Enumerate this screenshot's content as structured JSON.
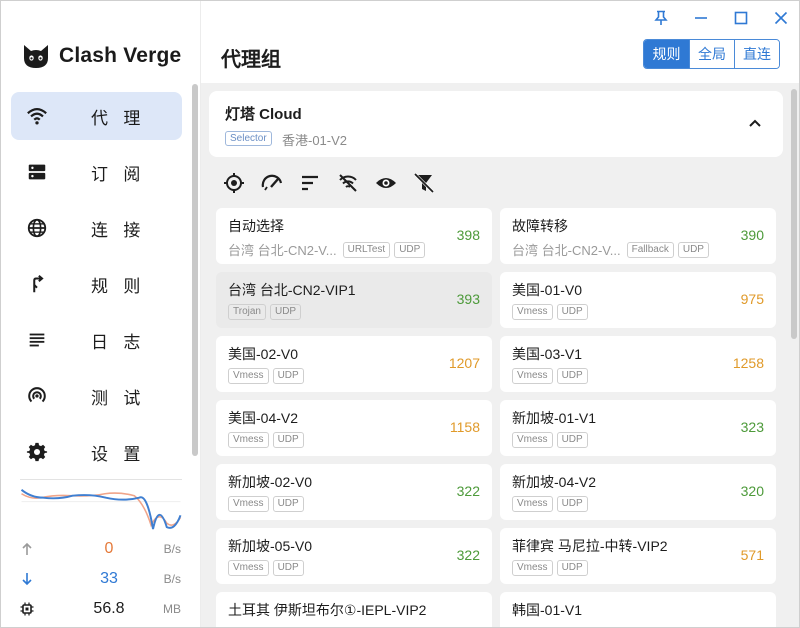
{
  "app": {
    "name": "Clash Verge"
  },
  "sidebar": {
    "items": [
      {
        "label": "代 理",
        "icon": "wifi-icon",
        "active": true
      },
      {
        "label": "订 阅",
        "icon": "server-icon",
        "active": false
      },
      {
        "label": "连 接",
        "icon": "globe-icon",
        "active": false
      },
      {
        "label": "规 则",
        "icon": "fork-arrow-icon",
        "active": false
      },
      {
        "label": "日 志",
        "icon": "log-lines-icon",
        "active": false
      },
      {
        "label": "测 试",
        "icon": "radar-icon",
        "active": false
      },
      {
        "label": "设 置",
        "icon": "gear-icon",
        "active": false
      }
    ],
    "traffic": {
      "upload": {
        "value": "0",
        "unit": "B/s",
        "color": "#e57a3a"
      },
      "download": {
        "value": "33",
        "unit": "B/s",
        "color": "#2f79d4"
      },
      "memory": {
        "value": "56.8",
        "unit": "MB"
      }
    }
  },
  "header": {
    "title": "代理组",
    "modes": [
      {
        "label": "规则",
        "active": true
      },
      {
        "label": "全局",
        "active": false
      },
      {
        "label": "直连",
        "active": false
      }
    ],
    "window_controls": [
      "pin-icon",
      "minimize-icon",
      "maximize-icon",
      "close-icon"
    ]
  },
  "group": {
    "name": "灯塔 Cloud",
    "type": "Selector",
    "now": "香港-01-V2"
  },
  "toolbar": [
    "locate-icon",
    "speed-test-icon",
    "sort-icon",
    "filter-off-icon",
    "eye-icon",
    "filter-clear-icon"
  ],
  "proxies": [
    {
      "name": "自动选择",
      "loc": "台湾 台北-CN2-V...",
      "tags": [
        "URLTest",
        "UDP"
      ],
      "delay": "398",
      "level": "green"
    },
    {
      "name": "故障转移",
      "loc": "台湾 台北-CN2-V...",
      "tags": [
        "Fallback",
        "UDP"
      ],
      "delay": "390",
      "level": "green"
    },
    {
      "name": "台湾 台北-CN2-VIP1",
      "loc": "",
      "tags": [
        "Trojan",
        "UDP"
      ],
      "delay": "393",
      "level": "green",
      "selected": true
    },
    {
      "name": "美国-01-V0",
      "loc": "",
      "tags": [
        "Vmess",
        "UDP"
      ],
      "delay": "975",
      "level": "orange"
    },
    {
      "name": "美国-02-V0",
      "loc": "",
      "tags": [
        "Vmess",
        "UDP"
      ],
      "delay": "1207",
      "level": "orange"
    },
    {
      "name": "美国-03-V1",
      "loc": "",
      "tags": [
        "Vmess",
        "UDP"
      ],
      "delay": "1258",
      "level": "orange"
    },
    {
      "name": "美国-04-V2",
      "loc": "",
      "tags": [
        "Vmess",
        "UDP"
      ],
      "delay": "1158",
      "level": "orange"
    },
    {
      "name": "新加坡-01-V1",
      "loc": "",
      "tags": [
        "Vmess",
        "UDP"
      ],
      "delay": "323",
      "level": "green"
    },
    {
      "name": "新加坡-02-V0",
      "loc": "",
      "tags": [
        "Vmess",
        "UDP"
      ],
      "delay": "322",
      "level": "green"
    },
    {
      "name": "新加坡-04-V2",
      "loc": "",
      "tags": [
        "Vmess",
        "UDP"
      ],
      "delay": "320",
      "level": "green"
    },
    {
      "name": "新加坡-05-V0",
      "loc": "",
      "tags": [
        "Vmess",
        "UDP"
      ],
      "delay": "322",
      "level": "green"
    },
    {
      "name": "菲律宾 马尼拉-中转-VIP2",
      "loc": "",
      "tags": [
        "Vmess",
        "UDP"
      ],
      "delay": "571",
      "level": "orange"
    },
    {
      "name": "土耳其 伊斯坦布尔①-IEPL-VIP2",
      "loc": "",
      "tags": [],
      "delay": "",
      "level": "green"
    },
    {
      "name": "韩国-01-V1",
      "loc": "",
      "tags": [],
      "delay": "",
      "level": "green"
    }
  ]
}
